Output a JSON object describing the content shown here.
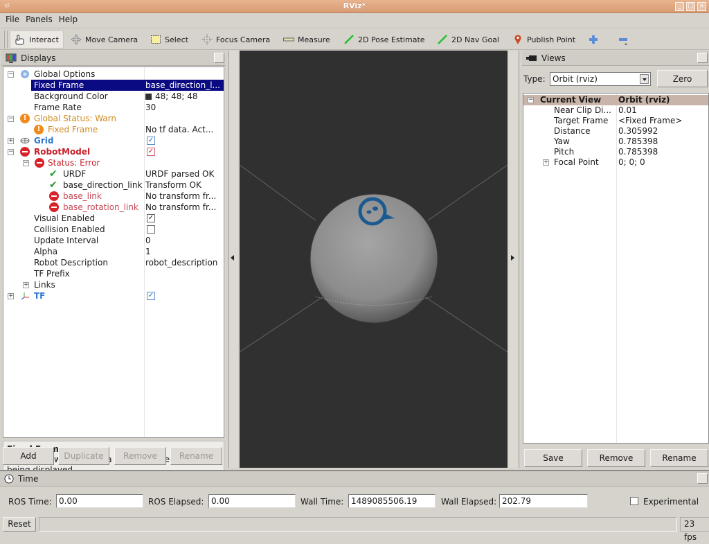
{
  "window": {
    "title": "RViz*",
    "app_glyph": "qt"
  },
  "menu": [
    "File",
    "Panels",
    "Help"
  ],
  "toolbar": {
    "tools": [
      {
        "label": "Interact",
        "icon": "hand-icon",
        "active": true
      },
      {
        "label": "Move Camera",
        "icon": "move-camera-icon"
      },
      {
        "label": "Select",
        "icon": "select-icon"
      },
      {
        "label": "Focus Camera",
        "icon": "focus-camera-icon"
      },
      {
        "label": "Measure",
        "icon": "ruler-icon"
      },
      {
        "label": "2D Pose Estimate",
        "icon": "green-arrow-icon"
      },
      {
        "label": "2D Nav Goal",
        "icon": "green-arrow-icon"
      },
      {
        "label": "Publish Point",
        "icon": "map-pin-icon"
      }
    ],
    "add_tool_icon": "plus-icon",
    "remove_tool_icon": "minus-icon"
  },
  "displays": {
    "title": "Displays",
    "rows": [
      {
        "label": "Global Options",
        "value": ""
      },
      {
        "label": "Fixed Frame",
        "value": "base_direction_l..."
      },
      {
        "label": "Background Color",
        "value": "48; 48; 48"
      },
      {
        "label": "Frame Rate",
        "value": "30"
      },
      {
        "label": "Global Status: Warn",
        "value": ""
      },
      {
        "label": "Fixed Frame",
        "value": "No tf data.  Act..."
      },
      {
        "label": "Grid",
        "value": ""
      },
      {
        "label": "RobotModel",
        "value": ""
      },
      {
        "label": "Status: Error",
        "value": ""
      },
      {
        "label": "URDF",
        "value": "URDF parsed OK"
      },
      {
        "label": "base_direction_link",
        "value": "Transform OK"
      },
      {
        "label": "base_link",
        "value": "No transform fr..."
      },
      {
        "label": "base_rotation_link",
        "value": "No transform fr..."
      },
      {
        "label": "Visual Enabled",
        "value": ""
      },
      {
        "label": "Collision Enabled",
        "value": ""
      },
      {
        "label": "Update Interval",
        "value": "0"
      },
      {
        "label": "Alpha",
        "value": "1"
      },
      {
        "label": "Robot Description",
        "value": "robot_description"
      },
      {
        "label": "TF Prefix",
        "value": ""
      },
      {
        "label": "Links",
        "value": ""
      },
      {
        "label": "TF",
        "value": ""
      }
    ],
    "checks": {
      "grid": true,
      "robot_model": true,
      "visual_enabled": true,
      "collision_enabled": false,
      "tf": true
    },
    "background_color_hex": "#303030",
    "description_title": "Fixed Frame",
    "description_text": "Frame into which all data is transformed before being displayed.",
    "buttons": {
      "add": "Add",
      "duplicate": "Duplicate",
      "remove": "Remove",
      "rename": "Rename"
    }
  },
  "views": {
    "title": "Views",
    "type_label": "Type:",
    "type_value": "Orbit (rviz)",
    "zero_label": "Zero",
    "rows": [
      {
        "label": "Current View",
        "value": "Orbit (rviz)"
      },
      {
        "label": "Near Clip Di...",
        "value": "0.01"
      },
      {
        "label": "Target Frame",
        "value": "<Fixed Frame>"
      },
      {
        "label": "Distance",
        "value": "0.305992"
      },
      {
        "label": "Yaw",
        "value": "0.785398"
      },
      {
        "label": "Pitch",
        "value": "0.785398"
      },
      {
        "label": "Focal Point",
        "value": "0; 0; 0"
      }
    ],
    "buttons": {
      "save": "Save",
      "remove": "Remove",
      "rename": "Rename"
    }
  },
  "time": {
    "title": "Time",
    "ros_time_label": "ROS Time:",
    "ros_time": "0.00",
    "ros_elapsed_label": "ROS Elapsed:",
    "ros_elapsed": "0.00",
    "wall_time_label": "Wall Time:",
    "wall_time": "1489085506.19",
    "wall_elapsed_label": "Wall Elapsed:",
    "wall_elapsed": "202.79",
    "experimental_label": "Experimental",
    "experimental": false
  },
  "status": {
    "reset_label": "Reset",
    "fps": "23 fps"
  },
  "colors": {
    "selection": "#0a0a82",
    "warn": "#f08a1c",
    "error": "#d8232a",
    "ok": "#1f9a2a",
    "title_bar": "#e0a880",
    "viewport_bg": "#303030",
    "sphere_logo": "#1a5a90"
  }
}
